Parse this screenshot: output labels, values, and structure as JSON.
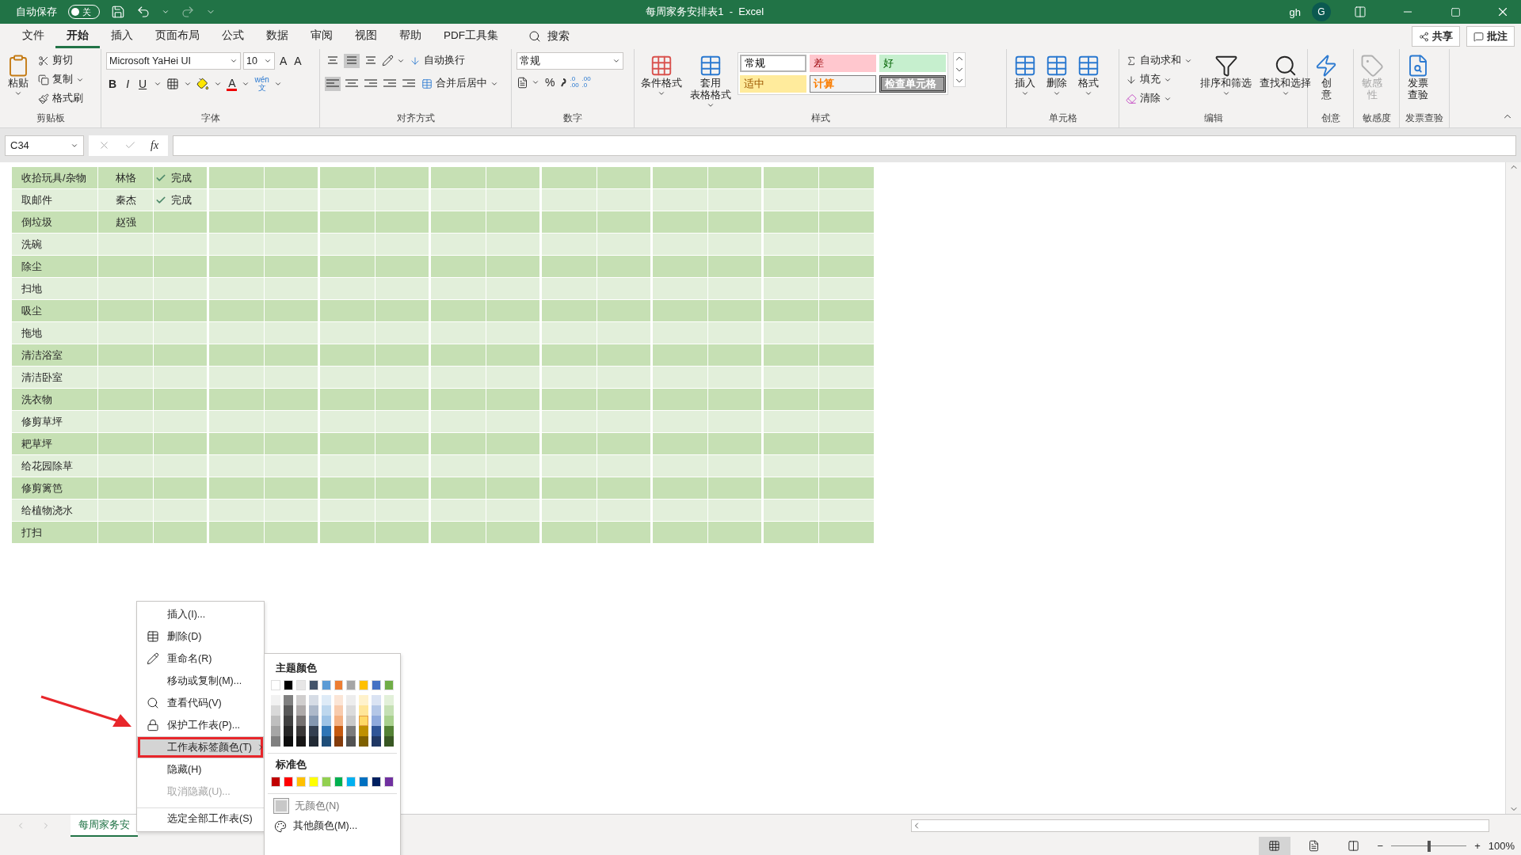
{
  "title_bar": {
    "autosave_label": "自动保存",
    "autosave": {
      "on": false,
      "label": "关"
    },
    "title": "每周家务安排表1  -  Excel",
    "user": "gh",
    "avatar": "G"
  },
  "menu_tabs": [
    {
      "label": "文件",
      "selected": false
    },
    {
      "label": "开始",
      "selected": true
    },
    {
      "label": "插入",
      "selected": false
    },
    {
      "label": "页面布局",
      "selected": false
    },
    {
      "label": "公式",
      "selected": false
    },
    {
      "label": "数据",
      "selected": false
    },
    {
      "label": "审阅",
      "selected": false
    },
    {
      "label": "视图",
      "selected": false
    },
    {
      "label": "帮助",
      "selected": false
    },
    {
      "label": "PDF工具集",
      "selected": false
    }
  ],
  "search": "搜索",
  "share": "共享",
  "comments": "批注",
  "ribbon": [
    {
      "kind": "clipboard",
      "label": "剪贴板",
      "paste": "粘贴",
      "items": [
        "剪切",
        "复制",
        "格式刷"
      ]
    },
    {
      "kind": "font",
      "label": "字体",
      "font_name": "Microsoft YaHei UI",
      "font_size": "10",
      "size_buttons": [
        "A",
        "A"
      ],
      "style_buttons": [
        "B",
        "I",
        "U"
      ],
      "font_color": "A",
      "phonetic": [
        "wén",
        "文"
      ]
    },
    {
      "kind": "alignment",
      "label": "对齐方式",
      "wrap": "自动换行",
      "merge": "合并后居中"
    },
    {
      "kind": "number",
      "label": "数字",
      "format": "常规",
      "percent": "%",
      "decimals": [
        [
          ".0",
          ".00"
        ],
        [
          ".00",
          ".0"
        ]
      ]
    },
    {
      "kind": "styles",
      "label": "样式",
      "buttons": [
        [
          "条件格式"
        ],
        [
          "套用",
          "表格格式"
        ]
      ],
      "cell_styles": [
        {
          "label": "常规",
          "kind": "normal"
        },
        {
          "label": "差",
          "kind": "bad"
        },
        {
          "label": "好",
          "kind": "good"
        },
        {
          "label": "适中",
          "kind": "neutral"
        },
        {
          "label": "计算",
          "kind": "calculation"
        },
        {
          "label": "检查单元格",
          "kind": "check"
        }
      ]
    },
    {
      "kind": "cells",
      "label": "单元格",
      "buttons": [
        "插入",
        "删除",
        "格式"
      ]
    },
    {
      "kind": "editing",
      "label": "编辑",
      "small": [
        "自动求和",
        "填充",
        "清除"
      ],
      "buttons": [
        "排序和筛选",
        "查找和选择"
      ]
    },
    {
      "kind": "ideas",
      "label": "创意",
      "button": [
        "创",
        "意"
      ],
      "disabled": false
    },
    {
      "kind": "sensitivity",
      "label": "敏感度",
      "button": [
        "敏感",
        "性"
      ],
      "disabled": true
    },
    {
      "kind": "invoice",
      "label": "发票查验",
      "button": [
        "发票",
        "查验"
      ],
      "disabled": false
    }
  ],
  "formula_bar": {
    "name_box": "C34",
    "fx": "fx"
  },
  "sheet": {
    "rows": [
      {
        "task": "收拾玩具/杂物",
        "person": "林恪",
        "status": "完成"
      },
      {
        "task": "取邮件",
        "person": "秦杰",
        "status": "完成"
      },
      {
        "task": "倒垃圾",
        "person": "赵强"
      },
      {
        "task": "洗碗"
      },
      {
        "task": "除尘"
      },
      {
        "task": "扫地"
      },
      {
        "task": "吸尘"
      },
      {
        "task": "拖地"
      },
      {
        "task": "清洁浴室"
      },
      {
        "task": "清洁卧室"
      },
      {
        "task": "洗衣物"
      },
      {
        "task": "修剪草坪"
      },
      {
        "task": "耙草坪"
      },
      {
        "task": "给花园除草"
      },
      {
        "task": "修剪篱笆"
      },
      {
        "task": "给植物浇水"
      },
      {
        "task": "打扫"
      }
    ]
  },
  "sheet_tabs": [
    {
      "label": "每周家务安",
      "selected": true
    }
  ],
  "context_menu": {
    "items": [
      {
        "label": "插入(I)...",
        "kind": "plain",
        "disabled": false,
        "highlighted": false,
        "annotated": false
      },
      {
        "label": "删除(D)",
        "kind": "delete",
        "disabled": false,
        "highlighted": false,
        "annotated": false
      },
      {
        "label": "重命名(R)",
        "kind": "rename",
        "disabled": false,
        "highlighted": false,
        "annotated": false
      },
      {
        "label": "移动或复制(M)...",
        "kind": "plain",
        "disabled": false,
        "highlighted": false,
        "annotated": false
      },
      {
        "label": "查看代码(V)",
        "kind": "code",
        "disabled": false,
        "highlighted": false,
        "annotated": false
      },
      {
        "label": "保护工作表(P)...",
        "kind": "protect",
        "disabled": false,
        "highlighted": false,
        "annotated": false
      },
      {
        "label": "工作表标签颜色(T)",
        "kind": "submenu",
        "disabled": false,
        "highlighted": true,
        "annotated": true
      },
      {
        "label": "隐藏(H)",
        "kind": "plain",
        "disabled": false,
        "highlighted": false,
        "annotated": false
      },
      {
        "label": "取消隐藏(U)...",
        "kind": "plain",
        "disabled": true,
        "highlighted": false,
        "annotated": false
      },
      {
        "label": "选定全部工作表(S)",
        "kind": "plain",
        "separator_before": true,
        "disabled": false,
        "highlighted": false,
        "annotated": false
      }
    ]
  },
  "color_menu": {
    "theme_title": "主题颜色",
    "theme": [
      {
        "color": "#ffffff",
        "shades": [
          {
            "color": "#f2f2f2",
            "selected": false
          },
          {
            "color": "#d9d9d9",
            "selected": false
          },
          {
            "color": "#bfbfbf",
            "selected": false
          },
          {
            "color": "#a6a6a6",
            "selected": false
          },
          {
            "color": "#808080",
            "selected": false
          }
        ]
      },
      {
        "color": "#000000",
        "shades": [
          {
            "color": "#808080",
            "selected": false
          },
          {
            "color": "#595959",
            "selected": false
          },
          {
            "color": "#404040",
            "selected": false
          },
          {
            "color": "#262626",
            "selected": false
          },
          {
            "color": "#0d0d0d",
            "selected": false
          }
        ]
      },
      {
        "color": "#e7e6e6",
        "shades": [
          {
            "color": "#d0cece",
            "selected": false
          },
          {
            "color": "#aeaaaa",
            "selected": false
          },
          {
            "color": "#757171",
            "selected": false
          },
          {
            "color": "#3a3838",
            "selected": false
          },
          {
            "color": "#171616",
            "selected": false
          }
        ]
      },
      {
        "color": "#44546a",
        "shades": [
          {
            "color": "#d6dce5",
            "selected": false
          },
          {
            "color": "#adb9ca",
            "selected": false
          },
          {
            "color": "#8497b0",
            "selected": false
          },
          {
            "color": "#333f50",
            "selected": false
          },
          {
            "color": "#222a35",
            "selected": false
          }
        ]
      },
      {
        "color": "#5b9bd5",
        "shades": [
          {
            "color": "#deebf7",
            "selected": false
          },
          {
            "color": "#bdd7ee",
            "selected": false
          },
          {
            "color": "#9dc3e6",
            "selected": false
          },
          {
            "color": "#2e75b6",
            "selected": false
          },
          {
            "color": "#1f4e79",
            "selected": false
          }
        ]
      },
      {
        "color": "#ed7d31",
        "shades": [
          {
            "color": "#fbe5d6",
            "selected": false
          },
          {
            "color": "#f8cbad",
            "selected": false
          },
          {
            "color": "#f4b183",
            "selected": false
          },
          {
            "color": "#c55a11",
            "selected": false
          },
          {
            "color": "#843c0c",
            "selected": false
          }
        ]
      },
      {
        "color": "#a5a5a5",
        "shades": [
          {
            "color": "#ededed",
            "selected": false
          },
          {
            "color": "#dbdbdb",
            "selected": false
          },
          {
            "color": "#c9c9c9",
            "selected": false
          },
          {
            "color": "#7b7b7b",
            "selected": false
          },
          {
            "color": "#525252",
            "selected": false
          }
        ]
      },
      {
        "color": "#ffc000",
        "shades": [
          {
            "color": "#fff2cc",
            "selected": false
          },
          {
            "color": "#ffe699",
            "selected": false
          },
          {
            "color": "#ffd966",
            "selected": true
          },
          {
            "color": "#bf9000",
            "selected": false
          },
          {
            "color": "#7f6000",
            "selected": false
          }
        ]
      },
      {
        "color": "#4472c4",
        "shades": [
          {
            "color": "#dae3f3",
            "selected": false
          },
          {
            "color": "#b4c7e7",
            "selected": false
          },
          {
            "color": "#8faadc",
            "selected": false
          },
          {
            "color": "#2f5597",
            "selected": false
          },
          {
            "color": "#203864",
            "selected": false
          }
        ]
      },
      {
        "color": "#70ad47",
        "shades": [
          {
            "color": "#e2f0d9",
            "selected": false
          },
          {
            "color": "#c5e0b4",
            "selected": false
          },
          {
            "color": "#a9d18e",
            "selected": false
          },
          {
            "color": "#548235",
            "selected": false
          },
          {
            "color": "#385723",
            "selected": false
          }
        ]
      }
    ],
    "standard_title": "标准色",
    "standard": [
      {
        "color": "#c00000"
      },
      {
        "color": "#ff0000"
      },
      {
        "color": "#ffc000"
      },
      {
        "color": "#ffff00"
      },
      {
        "color": "#92d050"
      },
      {
        "color": "#00b050"
      },
      {
        "color": "#00b0f0"
      },
      {
        "color": "#0070c0"
      },
      {
        "color": "#002060"
      },
      {
        "color": "#7030a0"
      }
    ],
    "no_color": "无颜色(N)",
    "more": "其他颜色(M)..."
  },
  "status_bar": {
    "views": [
      {
        "kind": "normal",
        "selected": true
      },
      {
        "kind": "page_layout",
        "selected": false
      },
      {
        "kind": "page_break",
        "selected": false
      }
    ],
    "minus": "−",
    "plus": "+",
    "zoom": {
      "level": 0.5
    },
    "zoom_text": "100%"
  }
}
